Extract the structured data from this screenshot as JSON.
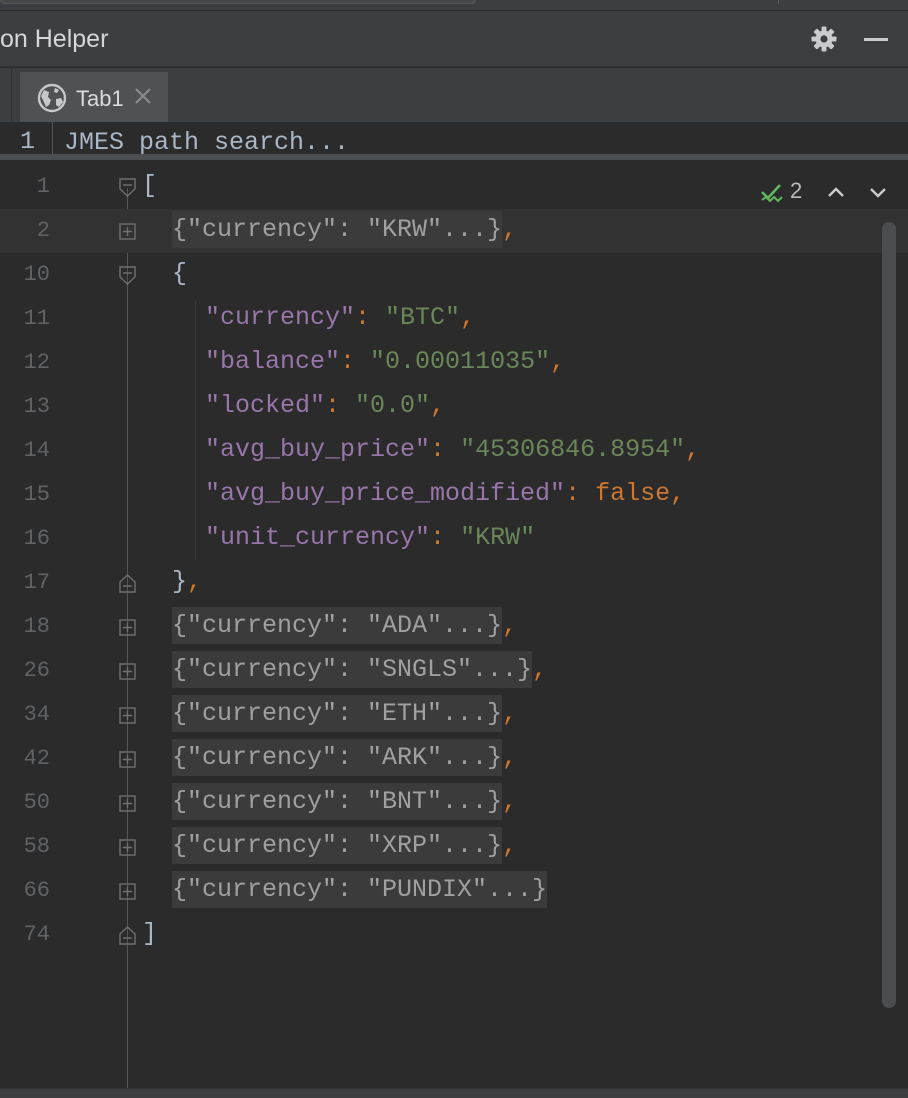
{
  "window": {
    "title": "on Helper"
  },
  "tabs": [
    {
      "label": "Tab1",
      "icon": "globe-icon",
      "close_icon": "close-icon"
    }
  ],
  "search": {
    "line_number": "1",
    "placeholder": "JMES path search..."
  },
  "inspection": {
    "icon": "double-check-icon",
    "count": "2",
    "up_icon": "chevron-up-icon",
    "down_icon": "chevron-down-icon"
  },
  "editor": {
    "lines": [
      {
        "ln": "1",
        "fold": "open",
        "open_text": "["
      },
      {
        "ln": "2",
        "fold": "collapsed",
        "folded": "{\"currency\": \"KRW\"...}",
        "trail": ","
      },
      {
        "ln": "10",
        "fold": "open",
        "open_text": "{"
      },
      {
        "ln": "11",
        "key": "\"currency\"",
        "value": "\"BTC\"",
        "trail": ","
      },
      {
        "ln": "12",
        "key": "\"balance\"",
        "value": "\"0.00011035\"",
        "trail": ","
      },
      {
        "ln": "13",
        "key": "\"locked\"",
        "value": "\"0.0\"",
        "trail": ","
      },
      {
        "ln": "14",
        "key": "\"avg_buy_price\"",
        "value": "\"45306846.8954\"",
        "trail": ","
      },
      {
        "ln": "15",
        "key": "\"avg_buy_price_modified\"",
        "value": "false",
        "trail": ","
      },
      {
        "ln": "16",
        "key": "\"unit_currency\"",
        "value": "\"KRW\"",
        "trail": ""
      },
      {
        "ln": "17",
        "fold": "close",
        "close_text": "}",
        "trail": ","
      },
      {
        "ln": "18",
        "fold": "collapsed",
        "folded": "{\"currency\": \"ADA\"...}",
        "trail": ","
      },
      {
        "ln": "26",
        "fold": "collapsed",
        "folded": "{\"currency\": \"SNGLS\"...}",
        "trail": ","
      },
      {
        "ln": "34",
        "fold": "collapsed",
        "folded": "{\"currency\": \"ETH\"...}",
        "trail": ","
      },
      {
        "ln": "42",
        "fold": "collapsed",
        "folded": "{\"currency\": \"ARK\"...}",
        "trail": ","
      },
      {
        "ln": "50",
        "fold": "collapsed",
        "folded": "{\"currency\": \"BNT\"...}",
        "trail": ","
      },
      {
        "ln": "58",
        "fold": "collapsed",
        "folded": "{\"currency\": \"XRP\"...}",
        "trail": ","
      },
      {
        "ln": "66",
        "fold": "collapsed",
        "folded": "{\"currency\": \"PUNDIX\"...}",
        "trail": ""
      },
      {
        "ln": "74",
        "fold": "close",
        "close_text": "]"
      }
    ],
    "colon": ": "
  },
  "colors": {
    "background": "#2b2b2b",
    "key": "#9876aa",
    "string": "#6a8759",
    "keyword": "#cc7832",
    "punctuation": "#cc7832",
    "text": "#a9b7c6",
    "line_number": "#606366"
  }
}
